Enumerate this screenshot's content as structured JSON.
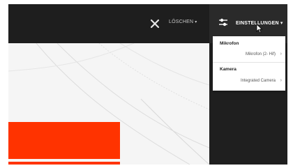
{
  "toolbar": {
    "delete_label": "LÖSCHEN",
    "delete_arrow": "▾",
    "settings_label": "EINSTELLUNGEN",
    "settings_arrow": "▾"
  },
  "settings_menu": {
    "microphone_section": "Mikrofon",
    "microphone_value": "Mikrofon (2- Hif)",
    "camera_section": "Kamera",
    "camera_value": "Integrated Camera",
    "chevron": "›"
  },
  "icons": {
    "close": "close-icon",
    "settings": "settings-sliders-icon",
    "cursor": "mouse-pointer-icon"
  },
  "colors": {
    "topbar": "#1e1e1e",
    "accent_red": "#ff3300",
    "menu_bg": "#ffffff"
  }
}
